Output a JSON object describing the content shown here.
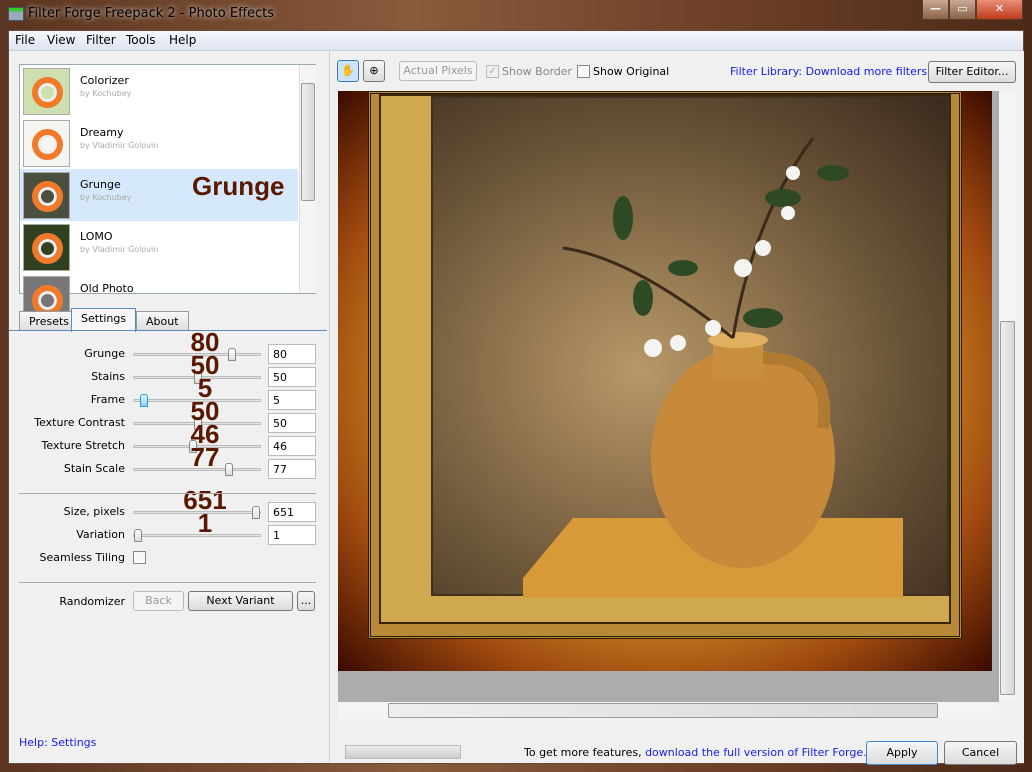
{
  "window": {
    "title": "Filter Forge Freepack 2 - Photo Effects",
    "minimize": "—",
    "maximize": "▭",
    "close": "✕"
  },
  "menu": [
    "File",
    "View",
    "Filter",
    "Tools",
    "Help"
  ],
  "filters": [
    {
      "name": "Colorizer",
      "author": "by Kochubey",
      "thumb": "#cfe0b0"
    },
    {
      "name": "Dreamy",
      "author": "by Vladimir Golovin",
      "thumb": "#f4f4f0"
    },
    {
      "name": "Grunge",
      "author": "by Kochubey",
      "thumb": "#4a5040",
      "selected": true
    },
    {
      "name": "LOMO",
      "author": "by Vladimir Golovin",
      "thumb": "#304020"
    },
    {
      "name": "Old Photo",
      "author": "",
      "thumb": "#777"
    }
  ],
  "selected_overlay": "Grunge",
  "tabs": [
    "Presets",
    "Settings",
    "About"
  ],
  "active_tab": "Settings",
  "settings": [
    {
      "label": "Grunge",
      "value": "80",
      "position": 0.78,
      "overlay": "80"
    },
    {
      "label": "Stains",
      "value": "50",
      "position": 0.5,
      "overlay": "50"
    },
    {
      "label": "Frame",
      "value": "5",
      "position": 0.05,
      "overlay": "5",
      "active": true
    },
    {
      "label": "Texture Contrast",
      "value": "50",
      "position": 0.5,
      "overlay": "50"
    },
    {
      "label": "Texture Stretch",
      "value": "46",
      "position": 0.46,
      "overlay": "46"
    },
    {
      "label": "Stain Scale",
      "value": "77",
      "position": 0.76,
      "overlay": "77"
    }
  ],
  "settings2": [
    {
      "label": "Size, pixels",
      "value": "651",
      "position": 0.98,
      "overlay": "651"
    },
    {
      "label": "Variation",
      "value": "1",
      "position": 0.0,
      "overlay": "1"
    }
  ],
  "seamless": {
    "label": "Seamless Tiling",
    "checked": false
  },
  "randomizer": {
    "label": "Randomizer",
    "back": "Back",
    "next": "Next Variant",
    "more": "..."
  },
  "help_link": "Help: Settings",
  "toolbar": {
    "hand": "hand-tool",
    "zoom": "zoom-tool",
    "actual_pixels": "Actual Pixels",
    "show_border": "Show Border",
    "show_border_checked": true,
    "show_original": "Show Original",
    "show_original_checked": false,
    "library_link": "Filter Library: Download more filters",
    "filter_editor": "Filter Editor..."
  },
  "footer": {
    "text": "To get more features, ",
    "link": "download the full version of Filter Forge.",
    "apply": "Apply",
    "cancel": "Cancel"
  }
}
